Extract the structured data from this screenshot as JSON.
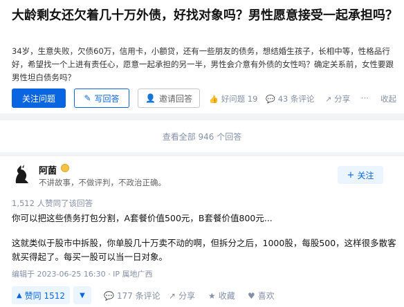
{
  "question": {
    "title": "大龄剩女还欠着几十万外债，好找对象吗？男性愿意接受一起承担吗？",
    "description": "34岁，生意失败，欠债60万，信用卡，小额贷，还有一些朋友的债务，想结婚生孩子，长相中等，性格品行好，希望找一个上进有责任心，愿意一起承担的另一半，男性会介意有外债的女性吗？确定关系前，女性要跟男性坦白债务吗？",
    "follow_label": "关注问题",
    "answer_label": "写回答",
    "invite_label": "邀请回答",
    "good_question_label": "好问题 19",
    "comments_label": "43 条评论",
    "share_label": "分享",
    "more_label": "···",
    "collapse_label": "收起"
  },
  "view_all_label": "查看全部 946 个回答",
  "answer": {
    "author_name": "阿菌",
    "author_bio": "不讲故事，不做评判，不政治正确。",
    "follow_label": "关注",
    "agree_text": "1,512 人赞同了该回答",
    "para1": "你可以把这些债务打包分割，A套餐价值500元，B套餐价值800元...",
    "para2": "这就类似于股市中拆股，你单股几十万卖不动的啊，但拆分之后，1000股，每股500，这样很多散客就买得起了。每买一股可以当一日对象。",
    "edit_meta": "编辑于 2023-06-25 16:30 · IP 属地广西",
    "vote_label": "赞同 1512",
    "comments_label": "177 条评论",
    "share_label": "分享",
    "collect_label": "收藏",
    "like_label": "喜欢"
  },
  "colors": {
    "primary": "#0a66e0",
    "meta": "#8590a6",
    "bg": "#f2f3f5"
  }
}
